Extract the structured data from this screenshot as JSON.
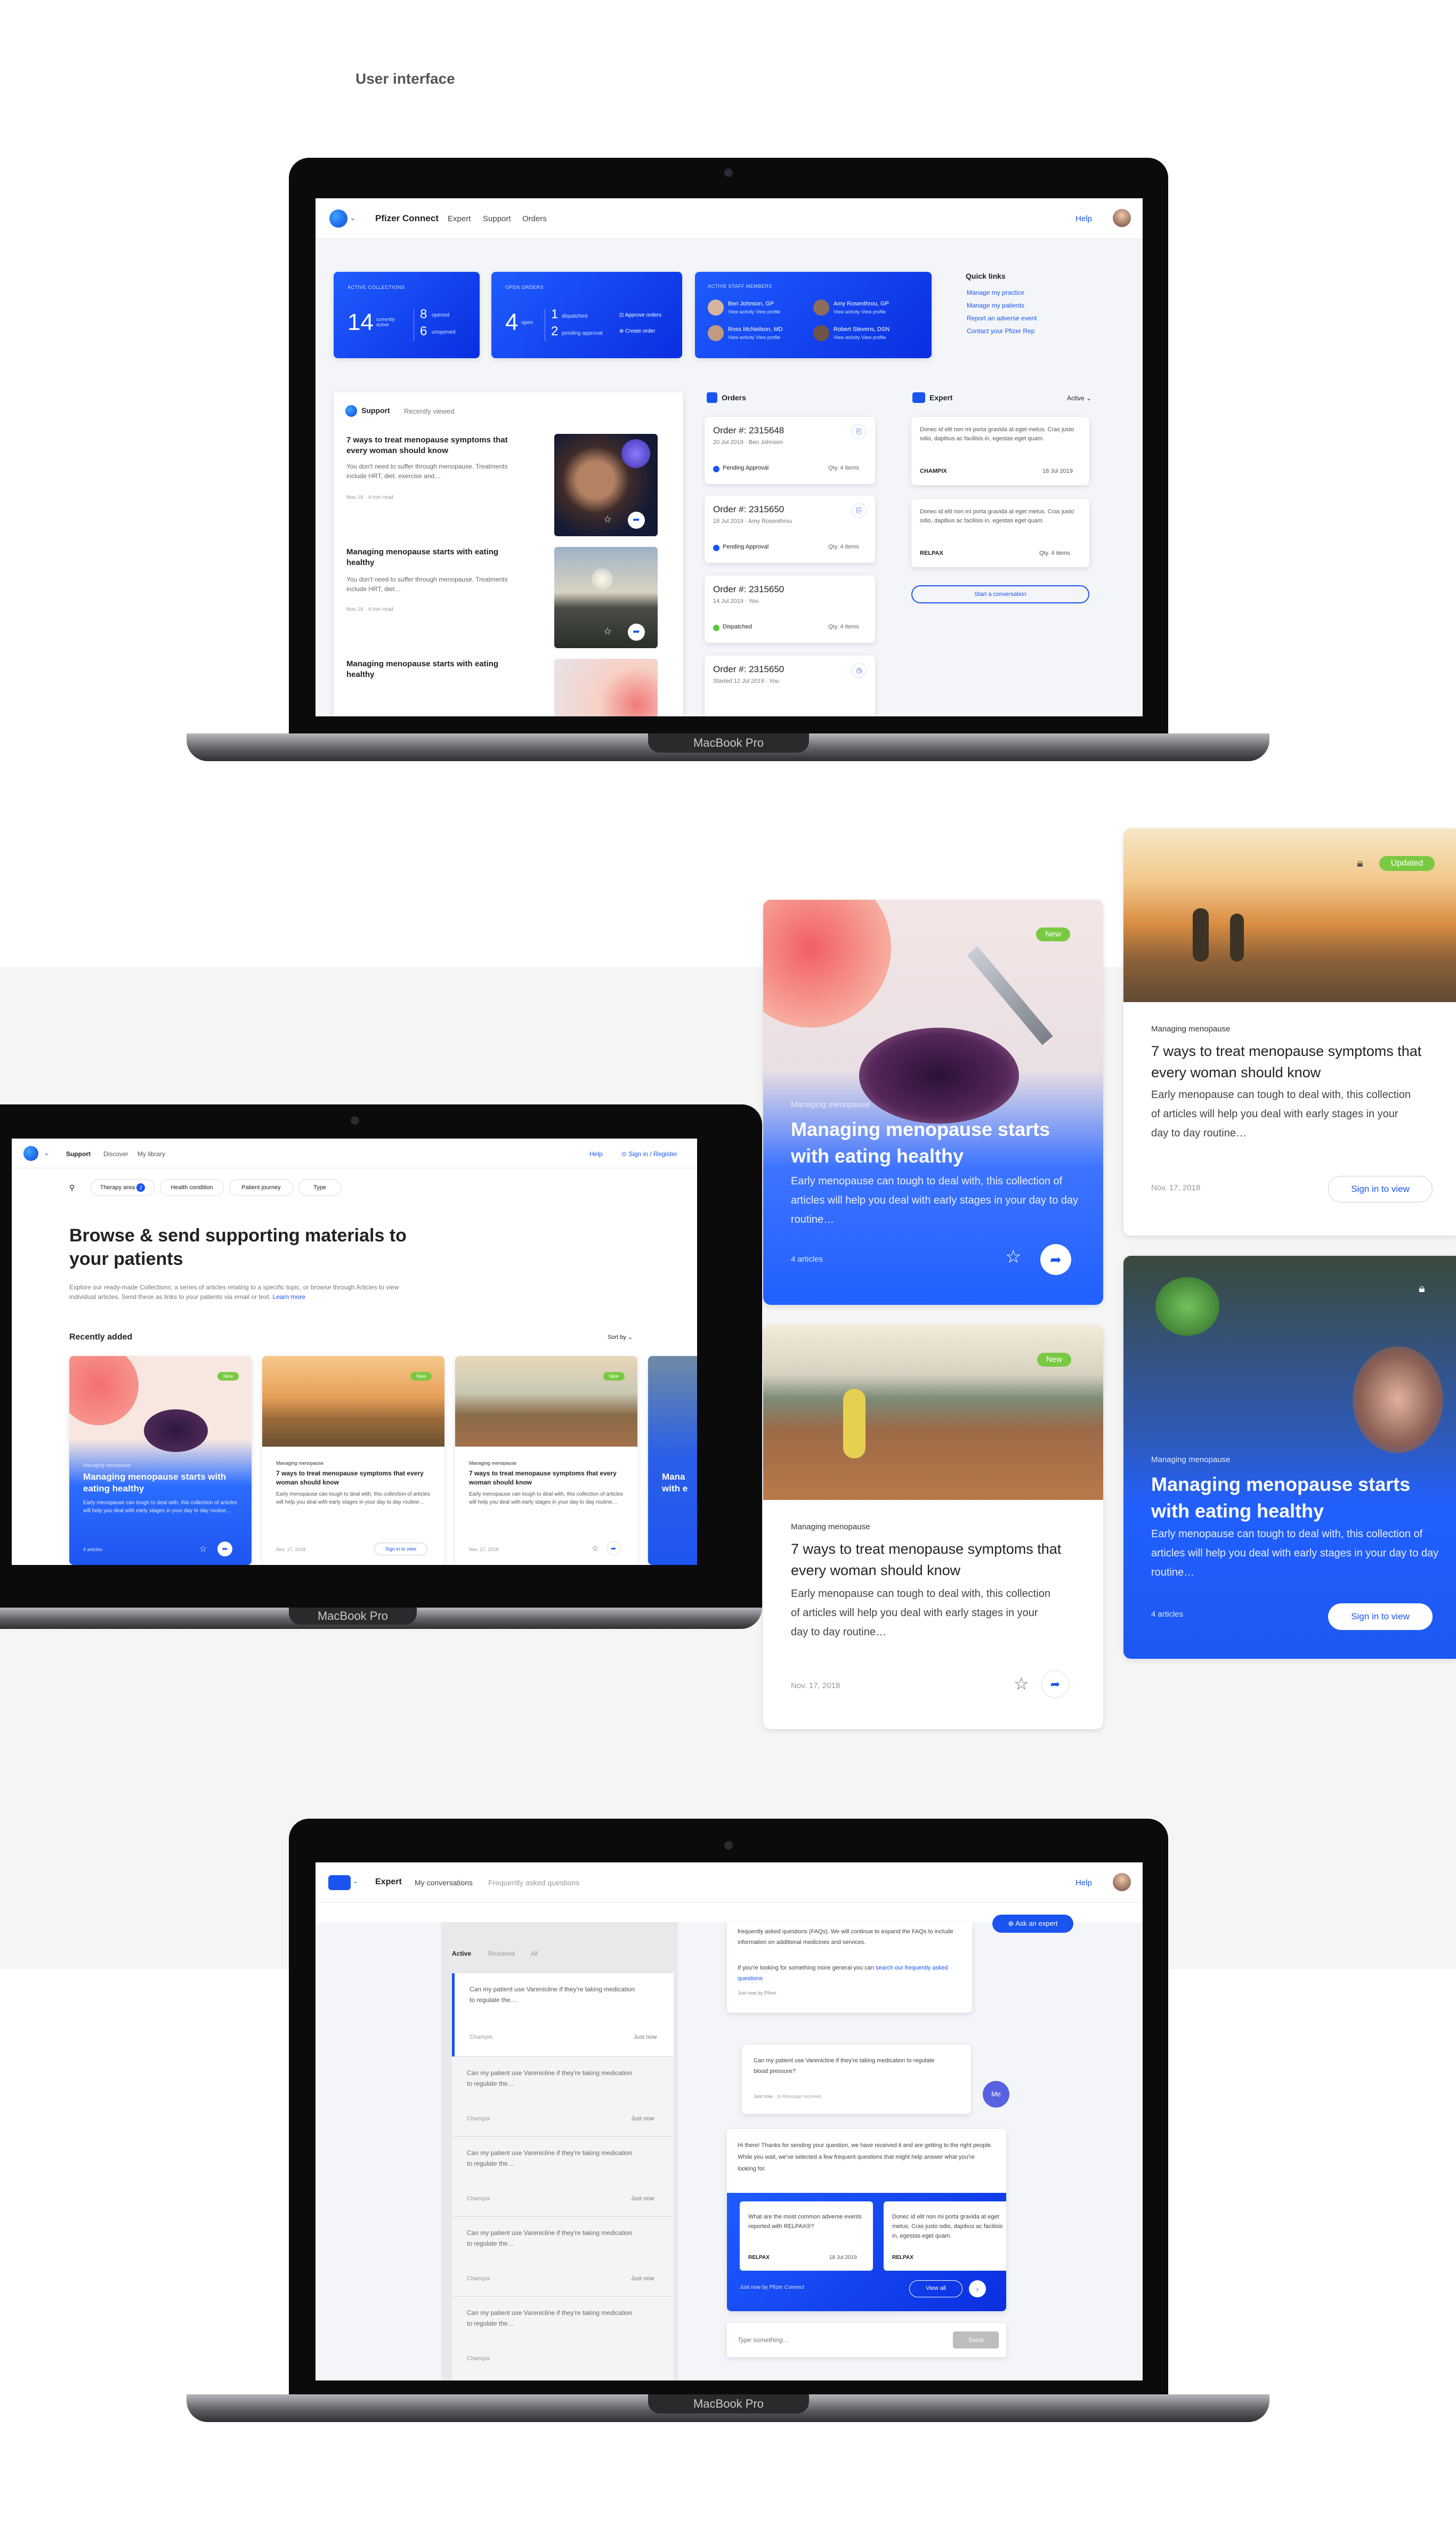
{
  "page": {
    "section_title": "User interface",
    "macbook_label": "MacBook Pro"
  },
  "dashboard": {
    "brand": "Pfizer Connect",
    "nav": [
      "Expert",
      "Support",
      "Orders"
    ],
    "help": "Help",
    "stats": [
      {
        "title": "ACTIVE COLLECTIONS",
        "big": "14",
        "big_label": "currently active",
        "a_num": "8",
        "a_label": "opened",
        "b_num": "6",
        "b_label": "unopened"
      },
      {
        "title": "OPEN ORDERS",
        "big": "4",
        "big_label": "open",
        "a_num": "1",
        "a_label": "dispatched",
        "b_num": "2",
        "b_label": "pending approval",
        "act1": "Approve orders",
        "act2": "Create order"
      }
    ],
    "staff": {
      "title": "ACTIVE STAFF MEMBERS",
      "people": [
        {
          "name": "Ben Johnson, GP",
          "links": "View activity   View profile"
        },
        {
          "name": "Amy Rosenthrou, GP",
          "links": "View activity   View profile"
        },
        {
          "name": "Ross McNeilson, MD",
          "links": "View activity   View profile"
        },
        {
          "name": "Robert Stevens, DSN",
          "links": "View activity   View profile"
        }
      ]
    },
    "quick_links": {
      "title": "Quick links",
      "items": [
        "Manage my practice",
        "Manage my patients",
        "Report an adverse event",
        "Contact your Pfizer Rep"
      ]
    },
    "support": {
      "tab_active": "Support",
      "tab_other": "Recently viewed",
      "articles": [
        {
          "title": "7 ways to treat menopause symptoms that every woman should know",
          "excerpt": "You don't need to suffer through menopause. Treatments include HRT, diet, exercise and…",
          "date": "Nov 16",
          "read": "4 min read"
        },
        {
          "title": "Managing menopause starts with eating healthy",
          "excerpt": "You don't need to suffer through menopause. Treatments include HRT, diet…",
          "date": "Nov 16",
          "read": "4 min read"
        },
        {
          "title": "Managing menopause starts with eating healthy",
          "excerpt": "",
          "date": "",
          "read": ""
        }
      ]
    },
    "orders": {
      "title": "Orders",
      "items": [
        {
          "num": "Order #: 2315648",
          "meta": "20 Jul 2019 · Ben Johnson",
          "status": "Pending Approval",
          "qty": "Qty. 4 items",
          "color": "#1a54f0"
        },
        {
          "num": "Order #: 2315650",
          "meta": "18 Jul 2019 · Amy Rosenthrou",
          "status": "Pending Approval",
          "qty": "Qty. 4 items",
          "color": "#1a54f0"
        },
        {
          "num": "Order #: 2315650",
          "meta": "14 Jul 2019 · You",
          "status": "Dispatched",
          "qty": "Qty. 4 items",
          "color": "#5fc33b"
        },
        {
          "num": "Order #: 2315650",
          "meta": "Started 12 Jul 2019 · You",
          "status": "",
          "qty": "",
          "color": "#1a54f0"
        }
      ]
    },
    "expert": {
      "title": "Expert",
      "filter": "Active",
      "items": [
        {
          "text": "Donec id elit non mi porta gravida at eget metus. Cras justo odio, dapibus ac facilisis in, egestas eget quam.",
          "tag": "CHAMPIX",
          "date": "18 Jul 2019"
        },
        {
          "text": "Donec id elit non mi porta gravida at eget metus. Cras justo odio, dapibus ac facilisis in, egestas eget quam.",
          "tag": "RELPAX",
          "date": "Qty. 4 items"
        }
      ],
      "cta": "Start a conversation"
    }
  },
  "library": {
    "nav": [
      "Support",
      "Discover",
      "My library"
    ],
    "help": "Help",
    "signin": "Sign in / Register",
    "filters": [
      "Therapy area",
      "Health condition",
      "Patient journey",
      "Type"
    ],
    "filter_badge": "2",
    "heading": "Browse & send supporting materials to your patients",
    "intro": "Explore our ready-made Collections; a series of articles relating to a specific topic, or browse through Articles to view individual articles. Send these as links to your patients via email or text.",
    "learn_more": "Learn more",
    "recent": "Recently added",
    "sort": "Sort by",
    "mini_cards": [
      {
        "kicker": "Managing menopause",
        "title": "Managing menopause starts with eating healthy",
        "text": "Early menopause can tough to deal with, this collection of articles will help you deal with early stages in your day to day routine…",
        "foot": "4 articles",
        "badge": "New"
      },
      {
        "kicker": "Managing menopause",
        "title": "7 ways to treat menopause symptoms that every woman should know",
        "text": "Early menopause can tough to deal with, this collection of articles will help you deal with early stages in your day to day routine…",
        "foot": "Nov. 17, 2018",
        "badge": "New",
        "cta": "Sign in to view"
      },
      {
        "kicker": "Managing menopause",
        "title": "7 ways to treat menopause symptoms that every woman should know",
        "text": "Early menopause can tough to deal with, this collection of articles will help you deal with early stages in your day to day routine…",
        "foot": "Nov. 17, 2018",
        "badge": "New"
      },
      {
        "kicker": "",
        "title": "Mana with e",
        "text": "",
        "foot": "",
        "badge": ""
      }
    ]
  },
  "cards": {
    "card1": {
      "badge": "New",
      "kicker": "Managing menopause",
      "title": "Managing menopause starts with eating healthy",
      "text": "Early menopause can tough to deal with, this collection of articles will help you deal with early stages in your day to day routine…",
      "foot": "4 articles"
    },
    "card2": {
      "badge": "New",
      "kicker": "Managing menopause",
      "title": "7 ways to treat menopause symptoms that every woman should know",
      "text": "Early menopause can tough to deal with, this collection of articles will help you deal with early stages in your day to day routine…",
      "foot": "Nov. 17, 2018"
    },
    "card3": {
      "badge": "Updated",
      "kicker": "Managing menopause",
      "title": "7 ways to treat menopause symptoms that every woman should know",
      "text": "Early menopause can tough to deal with, this collection of articles will help you deal with early stages in your day to day routine…",
      "foot": "Nov. 17, 2018",
      "cta": "Sign in to view"
    },
    "card4": {
      "kicker": "Managing menopause",
      "title": "Managing menopause starts with eating healthy",
      "text": "Early menopause can tough to deal with, this collection of articles will help you deal with early stages in your day to day routine…",
      "foot": "4 articles",
      "cta": "Sign in to view"
    }
  },
  "chat": {
    "nav": [
      "Expert",
      "My conversations",
      "Frequently asked questions"
    ],
    "help": "Help",
    "ask": "Ask an expert",
    "tabs": [
      "Active",
      "Resolved",
      "All"
    ],
    "conversations": [
      {
        "q": "Can my patient use Varenicline if they're taking medication to regulate the…",
        "tag": "Champix",
        "time": "Just now"
      },
      {
        "q": "Can my patient use Varenicline if they're taking medication to regulate the…",
        "tag": "Champix",
        "time": "Just now"
      },
      {
        "q": "Can my patient use Varenicline if they're taking medication to regulate the…",
        "tag": "Champix",
        "time": "Just now"
      },
      {
        "q": "Can my patient use Varenicline if they're taking medication to regulate the…",
        "tag": "Champix",
        "time": "Just now"
      },
      {
        "q": "Can my patient use Varenicline if they're taking medication to regulate the…",
        "tag": "Champix",
        "time": "Just now"
      }
    ],
    "msg1": {
      "text": "frequently asked questions (FAQs). We will continue to expand the FAQs to include information on additional medicines and services.",
      "text2": "If you're looking for something more general you can",
      "link": "search our frequently asked questions",
      "meta": "Just now by Pfizer"
    },
    "msg2": {
      "text": "Can my patient use Varenicline if they're taking medication to regulate blood pressure?",
      "meta": "Just now",
      "status": "Message received",
      "avatar": "Me"
    },
    "msg3": {
      "text": "Hi there! Thanks for sending your question, we have received it and are getting to the right people. While you wait, we've selected a few frequent questions that might help answer what you're looking for.",
      "faq1": "What are the most common adverse events reported with RELPAX®?",
      "faq1_tag": "RELPAX",
      "faq1_date": "18 Jul 2019",
      "faq2": "Donec id elit non mi porta gravida at eget metus. Cras justo odio, dapibus ac facilisis in, egestas eget quam.",
      "faq2_tag": "RELPAX",
      "meta": "Just now by Pfizer Connect",
      "view_all": "View all"
    },
    "input_placeholder": "Type something…",
    "send": "Send"
  }
}
